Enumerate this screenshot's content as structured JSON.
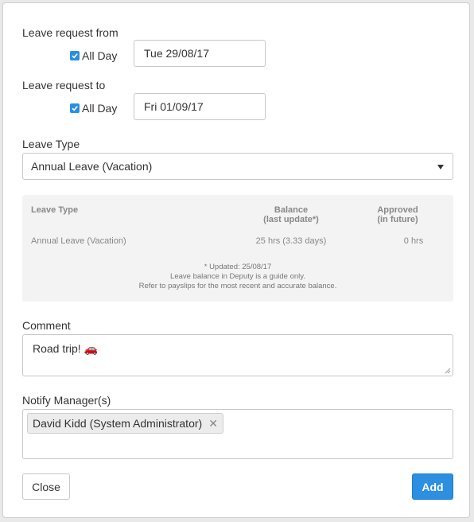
{
  "from": {
    "label": "Leave request from",
    "all_day_label": "All Day",
    "all_day_checked": true,
    "date": "Tue 29/08/17"
  },
  "to": {
    "label": "Leave request to",
    "all_day_label": "All Day",
    "all_day_checked": true,
    "date": "Fri 01/09/17"
  },
  "leave_type": {
    "label": "Leave Type",
    "selected": "Annual Leave (Vacation)"
  },
  "balance": {
    "col_type": "Leave Type",
    "col_balance_1": "Balance",
    "col_balance_2": "(last update*)",
    "col_approved_1": "Approved",
    "col_approved_2": "(in future)",
    "row": {
      "type": "Annual Leave (Vacation)",
      "balance": "25 hrs (3.33 days)",
      "approved": "0 hrs"
    },
    "note_1": "* Updated: 25/08/17",
    "note_2": "Leave balance in Deputy is a guide only.",
    "note_3": "Refer to payslips for the most recent and accurate balance."
  },
  "comment": {
    "label": "Comment",
    "value": "Road trip! 🚗"
  },
  "notify": {
    "label": "Notify Manager(s)",
    "chips": [
      "David Kidd (System Administrator)"
    ]
  },
  "buttons": {
    "close": "Close",
    "add": "Add"
  },
  "colors": {
    "accent": "#2c8fe0"
  }
}
